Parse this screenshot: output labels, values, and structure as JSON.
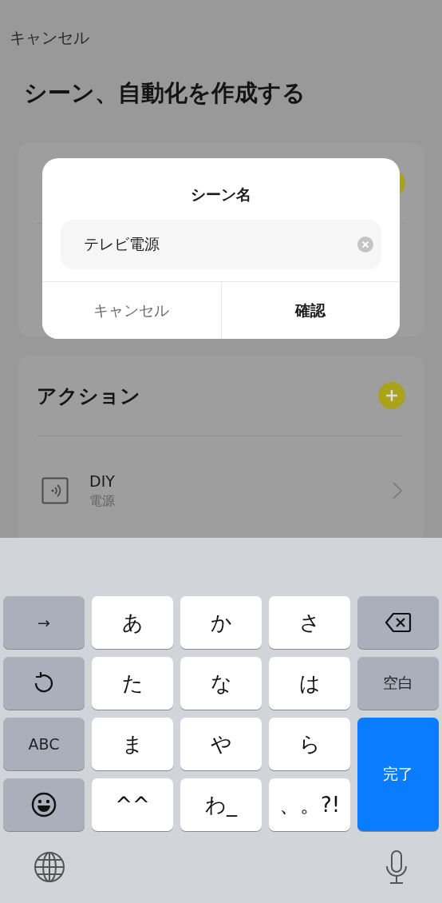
{
  "nav": {
    "cancel": "キャンセル"
  },
  "title": "シーン、自動化を作成する",
  "actions": {
    "title": "アクション",
    "items": [
      {
        "name": "DIY",
        "detail": "電源"
      }
    ]
  },
  "dialog": {
    "title": "シーン名",
    "field": {
      "value": "テレビ電源"
    },
    "buttons": [
      {
        "label": "キャンセル",
        "kind": "secondary"
      },
      {
        "label": "確認",
        "kind": "primary"
      }
    ]
  },
  "keyboard": {
    "keys": [
      {
        "kind": "function",
        "label": "→"
      },
      {
        "kind": "char",
        "label": "あ"
      },
      {
        "kind": "char",
        "label": "か"
      },
      {
        "kind": "char",
        "label": "さ"
      },
      {
        "kind": "backspace"
      },
      {
        "kind": "undo"
      },
      {
        "kind": "char",
        "label": "た"
      },
      {
        "kind": "char",
        "label": "な"
      },
      {
        "kind": "char",
        "label": "は"
      },
      {
        "kind": "function",
        "label": "空白"
      },
      {
        "kind": "function",
        "label": "ABC"
      },
      {
        "kind": "char",
        "label": "ま"
      },
      {
        "kind": "char",
        "label": "や"
      },
      {
        "kind": "char",
        "label": "ら"
      },
      {
        "kind": "primary",
        "label": "完了"
      },
      {
        "kind": "emoji"
      },
      {
        "kind": "char",
        "label": "^^"
      },
      {
        "kind": "char",
        "label": "わ_"
      },
      {
        "kind": "char",
        "label": "、。?!"
      }
    ]
  }
}
